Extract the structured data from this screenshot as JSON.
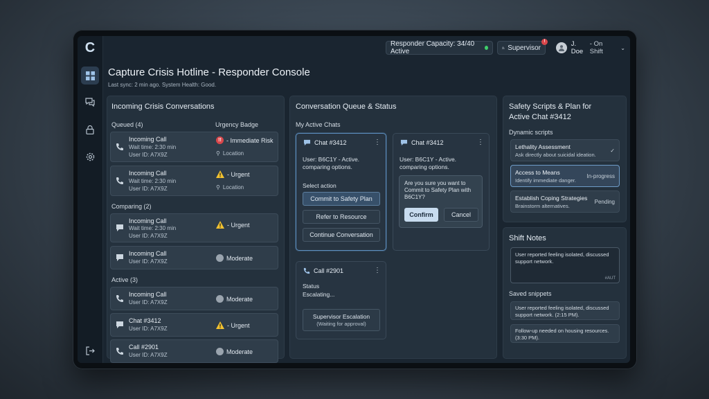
{
  "app": {
    "logo": "C",
    "title": "Capture Crisis Hotline - Responder Console",
    "subtitle": "Last sync: 2 min ago. System Health: Good."
  },
  "topbar": {
    "capacity": "Responder Capacity: 34/40 Active",
    "supervisor": "Supervisor",
    "supervisor_badge": "!",
    "user": "J. Doe",
    "user_status": " - On Shift"
  },
  "incoming": {
    "title": "Incoming Crisis Conversations",
    "urgency_header": "Urgency Badge",
    "groups": [
      {
        "label": "Queued (4)",
        "items": [
          {
            "title": "Incoming Call",
            "wait": "Wait time: 2:30 min",
            "user": "User ID: A7X9Z",
            "badge": "- Immediate Risk",
            "location": "Location",
            "kind": "call",
            "level": "red"
          },
          {
            "title": "Incoming Call",
            "wait": "Wait time: 2:30 min",
            "user": "User ID: A7X9Z",
            "badge": "- Urgent",
            "location": "Location",
            "kind": "call",
            "level": "warn"
          }
        ]
      },
      {
        "label": "Comparing (2)",
        "items": [
          {
            "title": "Incoming Call",
            "wait": "Wait time: 2:30 min",
            "user": "User ID: A7X9Z",
            "badge": "- Urgent",
            "kind": "chat",
            "level": "warn"
          },
          {
            "title": "Incoming Call",
            "user": "User ID: A7X9Z",
            "badge": "Moderate",
            "kind": "chat",
            "level": "grey"
          }
        ]
      },
      {
        "label": "Active (3)",
        "items": [
          {
            "title": "Incoming Call",
            "user": "User ID: A7X9Z",
            "badge": "Moderate",
            "kind": "call",
            "level": "grey"
          },
          {
            "title": "Chat #3412",
            "user": "User ID: A7X9Z",
            "badge": "- Urgent",
            "kind": "chat",
            "level": "warn"
          },
          {
            "title": "Call #2901",
            "user": "User ID: A7X9Z",
            "badge": "Moderate",
            "kind": "call",
            "level": "grey"
          }
        ]
      }
    ]
  },
  "queue": {
    "title": "Conversation Queue & Status",
    "my_chats": "My Active Chats",
    "chat1": {
      "title": "Chat #3412",
      "line1": "User: B6C1Y - Active.",
      "line2": "comparing options.",
      "select": "Select action",
      "actions": [
        "Commit to Safety Plan",
        "Refer to Resource",
        "Continue Conversation"
      ]
    },
    "chat2": {
      "title": "Chat #3412",
      "line1": "User: B6C1Y - Active.",
      "line2": "comparing options.",
      "confirm_text1": "Are you sure you want to",
      "confirm_text2": "Commit to Safety Plan with",
      "confirm_text3": "B6C1Y?",
      "confirm": "Confirm",
      "cancel": "Cancel"
    },
    "call": {
      "title": "Call #2901",
      "status_label": "Status",
      "status": "Escalating...",
      "escalation": "Supervisor Escalation",
      "escalation_sub": "(Waiting for approval)"
    }
  },
  "scripts": {
    "title1": "Safety Scripts & Plan for",
    "title2": "Active Chat #3412",
    "dynamic": "Dynamic scripts",
    "items": [
      {
        "title": "Lethality Assessment",
        "desc": "Ask directly about suicidal ideation.",
        "status": "✓"
      },
      {
        "title": "Access to Means",
        "desc": "Identify immediate danger.",
        "status": "In-progress"
      },
      {
        "title": "Establish Coping Strategies",
        "desc": "Brainstorm alternatives.",
        "status": "Pending"
      }
    ]
  },
  "notes": {
    "title": "Shift Notes",
    "current1": "User reported feeling isolated, discussed",
    "current2": "support network.",
    "autosave": "#AUT",
    "saved_label": "Saved snippets",
    "snippets": [
      {
        "l1": "User reported feeling isolated, discussed",
        "l2": "support network. (2:15 PM)."
      },
      {
        "l1": "Follow-up needed on housing resources.",
        "l2": "(3:30 PM)."
      }
    ]
  },
  "colors": {
    "accent": "#5d8fc0",
    "danger": "#d9474b",
    "warning": "#f2c230",
    "online": "#3fcf6a"
  }
}
